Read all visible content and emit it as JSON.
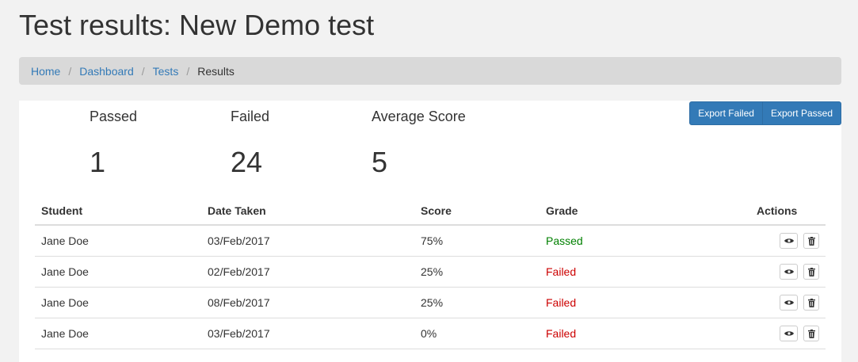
{
  "page": {
    "title": "Test results: New Demo test"
  },
  "breadcrumb": {
    "items": [
      {
        "label": "Home"
      },
      {
        "label": "Dashboard"
      },
      {
        "label": "Tests"
      },
      {
        "label": "Results"
      }
    ]
  },
  "stats": {
    "passed": {
      "label": "Passed",
      "value": "1"
    },
    "failed": {
      "label": "Failed",
      "value": "24"
    },
    "average": {
      "label": "Average Score",
      "value": "5"
    }
  },
  "export": {
    "failed_label": "Export Failed",
    "passed_label": "Export Passed"
  },
  "table": {
    "headers": {
      "student": "Student",
      "date": "Date Taken",
      "score": "Score",
      "grade": "Grade",
      "actions": "Actions"
    },
    "rows": [
      {
        "student": "Jane Doe",
        "date": "03/Feb/2017",
        "score": "75%",
        "grade": "Passed"
      },
      {
        "student": "Jane Doe",
        "date": "02/Feb/2017",
        "score": "25%",
        "grade": "Failed"
      },
      {
        "student": "Jane Doe",
        "date": "08/Feb/2017",
        "score": "25%",
        "grade": "Failed"
      },
      {
        "student": "Jane Doe",
        "date": "03/Feb/2017",
        "score": "0%",
        "grade": "Failed"
      }
    ],
    "row_actions": [
      {
        "icon": "eye-icon"
      },
      {
        "icon": "trash-icon"
      }
    ]
  },
  "colors": {
    "link": "#337ab7",
    "passed": "#008000",
    "failed": "#cc0000",
    "button": "#337ab7"
  }
}
